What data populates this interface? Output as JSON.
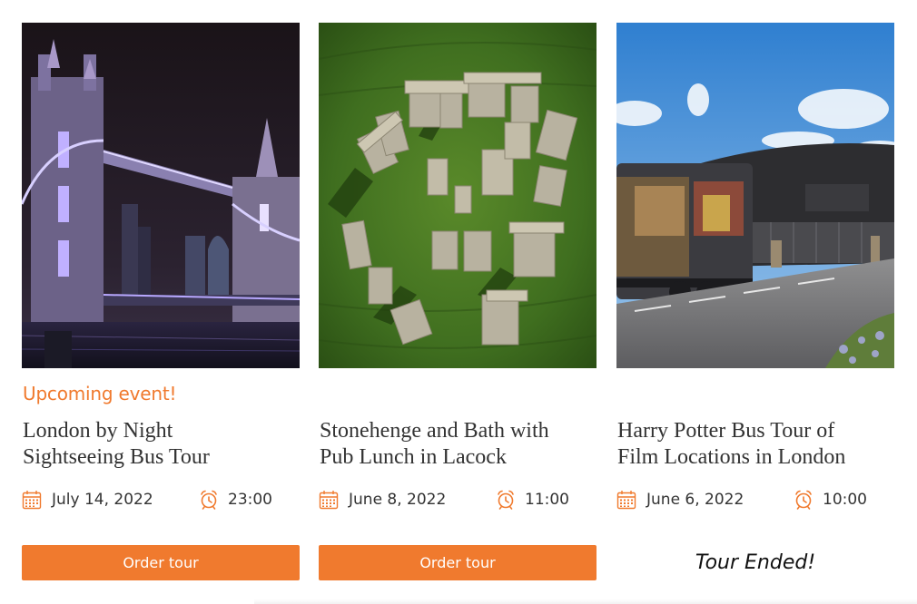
{
  "colors": {
    "accent": "#f07a2e",
    "text": "#333333"
  },
  "tours": [
    {
      "status": "Upcoming event!",
      "title_line1": "London by Night",
      "title_line2": "Sightseeing Bus Tour",
      "date": "July 14, 2022",
      "time": "23:00",
      "button": "Order tour",
      "image_subject": "tower-bridge-at-night"
    },
    {
      "title_line1": "Stonehenge and Bath with",
      "title_line2": "Pub Lunch in Lacock",
      "date": "June 8, 2022",
      "time": "11:00",
      "button": "Order tour",
      "image_subject": "stonehenge-aerial"
    },
    {
      "title_line1": "Harry Potter Bus Tour of",
      "title_line2": "Film Locations in London",
      "date": "June 6, 2022",
      "time": "10:00",
      "ended": "Tour Ended!",
      "image_subject": "harry-potter-studio-bus"
    }
  ]
}
